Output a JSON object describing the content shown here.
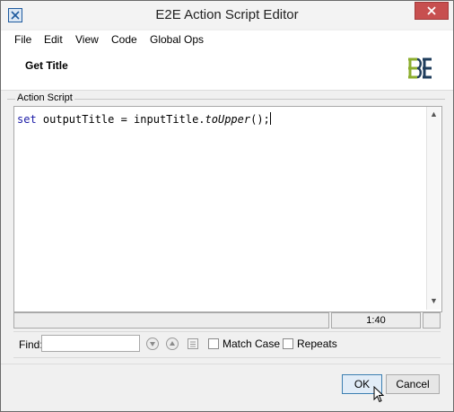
{
  "window": {
    "title": "E2E Action Script Editor"
  },
  "icons": {
    "app": "app-icon",
    "close": "close-icon",
    "logo": "e2e-logo",
    "find_next": "arrow-down-icon",
    "find_prev": "arrow-up-icon",
    "find_list": "list-icon",
    "cursor": "mouse-pointer-icon"
  },
  "menu": {
    "items": [
      "File",
      "Edit",
      "View",
      "Code",
      "Global Ops"
    ]
  },
  "header": {
    "title": "Get Title"
  },
  "script": {
    "group_label": "Action Script",
    "code_keyword": "set",
    "code_before_call": " outputTitle = inputTitle.",
    "code_call": "toUpper",
    "code_after_call": "();"
  },
  "status": {
    "position": "1:40"
  },
  "find": {
    "label": "Find:",
    "value": "",
    "match_case": "Match Case",
    "repeats": "Repeats",
    "match_case_checked": false,
    "repeats_checked": false
  },
  "buttons": {
    "ok": "OK",
    "cancel": "Cancel"
  },
  "colors": {
    "logo_green": "#8cae2e",
    "logo_navy": "#1f3d5c",
    "keyword": "#1a1aa6",
    "close_button": "#c74f4f"
  }
}
